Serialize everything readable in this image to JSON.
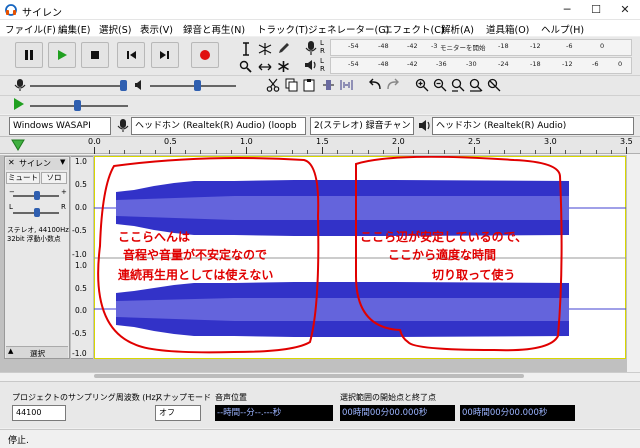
{
  "window": {
    "title": "サイレン",
    "minimize": "─",
    "maximize": "☐",
    "close": "✕"
  },
  "menu": [
    "ファイル(F)",
    "編集(E)",
    "選択(S)",
    "表示(V)",
    "録音と再生(N)",
    "トラック(T)",
    "ジェネレーター(G)",
    "エフェクト(C)",
    "解析(A)",
    "道具箱(O)",
    "ヘルプ(H)"
  ],
  "meter": {
    "rec_ticks": [
      "-54",
      "-48",
      "-42",
      "-3"
    ],
    "rec_hint": "モニターを開始",
    "ticks": [
      "-54",
      "-48",
      "-42",
      "-36",
      "-30",
      "-24",
      "-18",
      "-12",
      "-6",
      "0"
    ],
    "play_ticks": [
      "-54",
      "-48",
      "-42",
      "-36",
      "-30",
      "-24",
      "-18",
      "-12",
      "-6",
      "0"
    ],
    "L": "L",
    "R": "R"
  },
  "devices": {
    "host": "Windows WASAPI",
    "recording": "ヘッドホン (Realtek(R) Audio) (loopb",
    "channels": "2(ステレオ) 録音チャン",
    "playback": "ヘッドホン (Realtek(R) Audio)"
  },
  "ruler": {
    "ticks": [
      "0.0",
      "0.5",
      "1.0",
      "1.5",
      "2.0",
      "2.5",
      "3.0",
      "3.5"
    ]
  },
  "track": {
    "name": "サイレン",
    "mute": "ミュート",
    "solo": "ソロ",
    "L": "L",
    "R": "R",
    "info1": "ステレオ, 44100Hz",
    "info2": "32bit 浮動小数点",
    "select": "選択",
    "scale": [
      "1.0",
      "0.5",
      "0.0",
      "-0.5",
      "-1.0"
    ]
  },
  "annotations": {
    "left": [
      "ここらへんは",
      "音程や音量が不安定なので",
      "連続再生用としては使えない"
    ],
    "right": [
      "ここら辺が安定しているので、",
      "ここから適度な時間",
      "切り取って使う"
    ],
    "color": "#e00000"
  },
  "selbar": {
    "rate_label": "プロジェクトのサンプリング周波数 (Hz)",
    "rate_value": "44100",
    "snap_label": "スナップモード",
    "snap_value": "オフ",
    "pos_label": "音声位置",
    "pos_value": "--時間--分--.---秒",
    "range_label": "選択範囲の開始点と終了点",
    "start_value": "00時間00分00.000秒",
    "end_value": "00時間00分00.000秒"
  },
  "status": {
    "text": "停止."
  },
  "colors": {
    "wave": "#3232c8",
    "wave_light": "#6464dc",
    "track_bg": "#ffffff",
    "area_bg": "#c0c0c0",
    "accent": "#3a6ea5"
  }
}
